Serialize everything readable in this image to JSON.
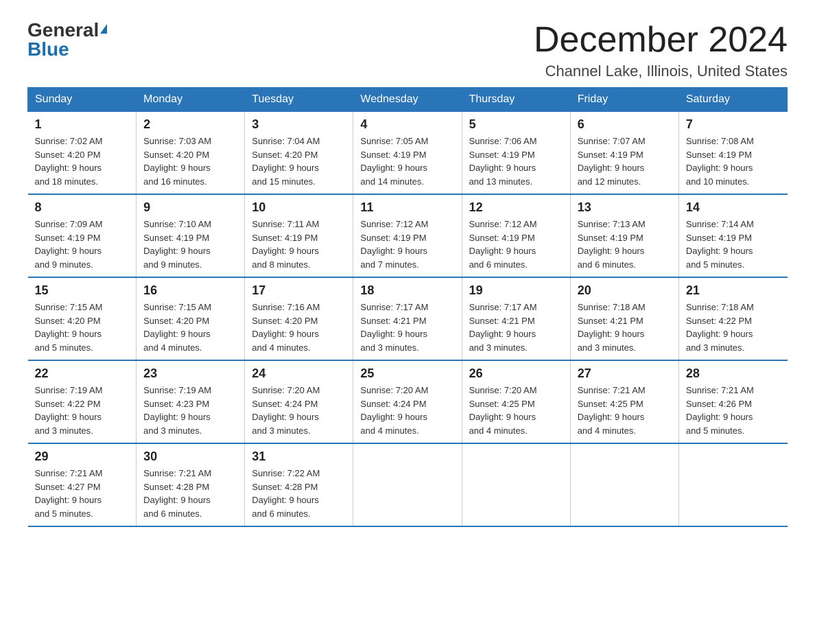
{
  "logo": {
    "general": "General",
    "blue": "Blue"
  },
  "title": "December 2024",
  "location": "Channel Lake, Illinois, United States",
  "days_of_week": [
    "Sunday",
    "Monday",
    "Tuesday",
    "Wednesday",
    "Thursday",
    "Friday",
    "Saturday"
  ],
  "weeks": [
    [
      {
        "day": "1",
        "sunrise": "7:02 AM",
        "sunset": "4:20 PM",
        "daylight": "9 hours and 18 minutes."
      },
      {
        "day": "2",
        "sunrise": "7:03 AM",
        "sunset": "4:20 PM",
        "daylight": "9 hours and 16 minutes."
      },
      {
        "day": "3",
        "sunrise": "7:04 AM",
        "sunset": "4:20 PM",
        "daylight": "9 hours and 15 minutes."
      },
      {
        "day": "4",
        "sunrise": "7:05 AM",
        "sunset": "4:19 PM",
        "daylight": "9 hours and 14 minutes."
      },
      {
        "day": "5",
        "sunrise": "7:06 AM",
        "sunset": "4:19 PM",
        "daylight": "9 hours and 13 minutes."
      },
      {
        "day": "6",
        "sunrise": "7:07 AM",
        "sunset": "4:19 PM",
        "daylight": "9 hours and 12 minutes."
      },
      {
        "day": "7",
        "sunrise": "7:08 AM",
        "sunset": "4:19 PM",
        "daylight": "9 hours and 10 minutes."
      }
    ],
    [
      {
        "day": "8",
        "sunrise": "7:09 AM",
        "sunset": "4:19 PM",
        "daylight": "9 hours and 9 minutes."
      },
      {
        "day": "9",
        "sunrise": "7:10 AM",
        "sunset": "4:19 PM",
        "daylight": "9 hours and 9 minutes."
      },
      {
        "day": "10",
        "sunrise": "7:11 AM",
        "sunset": "4:19 PM",
        "daylight": "9 hours and 8 minutes."
      },
      {
        "day": "11",
        "sunrise": "7:12 AM",
        "sunset": "4:19 PM",
        "daylight": "9 hours and 7 minutes."
      },
      {
        "day": "12",
        "sunrise": "7:12 AM",
        "sunset": "4:19 PM",
        "daylight": "9 hours and 6 minutes."
      },
      {
        "day": "13",
        "sunrise": "7:13 AM",
        "sunset": "4:19 PM",
        "daylight": "9 hours and 6 minutes."
      },
      {
        "day": "14",
        "sunrise": "7:14 AM",
        "sunset": "4:19 PM",
        "daylight": "9 hours and 5 minutes."
      }
    ],
    [
      {
        "day": "15",
        "sunrise": "7:15 AM",
        "sunset": "4:20 PM",
        "daylight": "9 hours and 5 minutes."
      },
      {
        "day": "16",
        "sunrise": "7:15 AM",
        "sunset": "4:20 PM",
        "daylight": "9 hours and 4 minutes."
      },
      {
        "day": "17",
        "sunrise": "7:16 AM",
        "sunset": "4:20 PM",
        "daylight": "9 hours and 4 minutes."
      },
      {
        "day": "18",
        "sunrise": "7:17 AM",
        "sunset": "4:21 PM",
        "daylight": "9 hours and 3 minutes."
      },
      {
        "day": "19",
        "sunrise": "7:17 AM",
        "sunset": "4:21 PM",
        "daylight": "9 hours and 3 minutes."
      },
      {
        "day": "20",
        "sunrise": "7:18 AM",
        "sunset": "4:21 PM",
        "daylight": "9 hours and 3 minutes."
      },
      {
        "day": "21",
        "sunrise": "7:18 AM",
        "sunset": "4:22 PM",
        "daylight": "9 hours and 3 minutes."
      }
    ],
    [
      {
        "day": "22",
        "sunrise": "7:19 AM",
        "sunset": "4:22 PM",
        "daylight": "9 hours and 3 minutes."
      },
      {
        "day": "23",
        "sunrise": "7:19 AM",
        "sunset": "4:23 PM",
        "daylight": "9 hours and 3 minutes."
      },
      {
        "day": "24",
        "sunrise": "7:20 AM",
        "sunset": "4:24 PM",
        "daylight": "9 hours and 3 minutes."
      },
      {
        "day": "25",
        "sunrise": "7:20 AM",
        "sunset": "4:24 PM",
        "daylight": "9 hours and 4 minutes."
      },
      {
        "day": "26",
        "sunrise": "7:20 AM",
        "sunset": "4:25 PM",
        "daylight": "9 hours and 4 minutes."
      },
      {
        "day": "27",
        "sunrise": "7:21 AM",
        "sunset": "4:25 PM",
        "daylight": "9 hours and 4 minutes."
      },
      {
        "day": "28",
        "sunrise": "7:21 AM",
        "sunset": "4:26 PM",
        "daylight": "9 hours and 5 minutes."
      }
    ],
    [
      {
        "day": "29",
        "sunrise": "7:21 AM",
        "sunset": "4:27 PM",
        "daylight": "9 hours and 5 minutes."
      },
      {
        "day": "30",
        "sunrise": "7:21 AM",
        "sunset": "4:28 PM",
        "daylight": "9 hours and 6 minutes."
      },
      {
        "day": "31",
        "sunrise": "7:22 AM",
        "sunset": "4:28 PM",
        "daylight": "9 hours and 6 minutes."
      },
      null,
      null,
      null,
      null
    ]
  ],
  "labels": {
    "sunrise": "Sunrise:",
    "sunset": "Sunset:",
    "daylight": "Daylight:"
  }
}
